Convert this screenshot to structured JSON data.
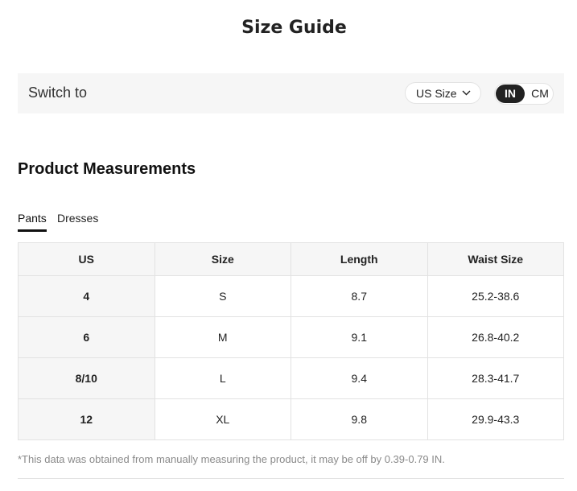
{
  "page": {
    "title": "Size Guide"
  },
  "switch_bar": {
    "label": "Switch to",
    "size_select": {
      "value": "US Size"
    },
    "units": {
      "active": "IN",
      "inactive": "CM"
    }
  },
  "section": {
    "title": "Product Measurements"
  },
  "tabs": [
    {
      "label": "Pants",
      "active": true
    },
    {
      "label": "Dresses",
      "active": false
    }
  ],
  "table": {
    "headers": [
      "US",
      "Size",
      "Length",
      "Waist Size"
    ],
    "rows": [
      [
        "4",
        "S",
        "8.7",
        "25.2-38.6"
      ],
      [
        "6",
        "M",
        "9.1",
        "26.8-40.2"
      ],
      [
        "8/10",
        "L",
        "9.4",
        "28.3-41.7"
      ],
      [
        "12",
        "XL",
        "9.8",
        "29.9-43.3"
      ]
    ]
  },
  "note": "*This data was obtained from manually measuring the product, it may be off by 0.39-0.79 IN."
}
